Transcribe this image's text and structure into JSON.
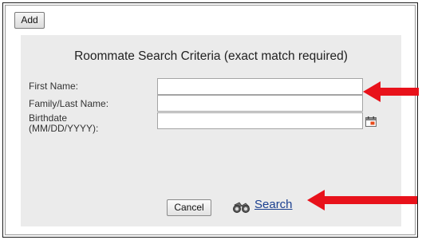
{
  "toolbar": {
    "add_label": "Add"
  },
  "panel": {
    "title": "Roommate Search Criteria (exact match required)",
    "fields": [
      {
        "label": "First Name:",
        "value": ""
      },
      {
        "label": "Family/Last Name:",
        "value": ""
      },
      {
        "label_line1": "Birthdate",
        "label_line2": "(MM/DD/YYYY):",
        "value": ""
      }
    ],
    "cancel_label": "Cancel",
    "search_label": "Search"
  },
  "icons": {
    "calendar": "calendar-icon",
    "search": "binoculars-icon",
    "annotation": "red-arrow-icon"
  },
  "colors": {
    "panel_bg": "#ebebeb",
    "link": "#1a3f8f",
    "annotation_arrow": "#e8121b"
  }
}
